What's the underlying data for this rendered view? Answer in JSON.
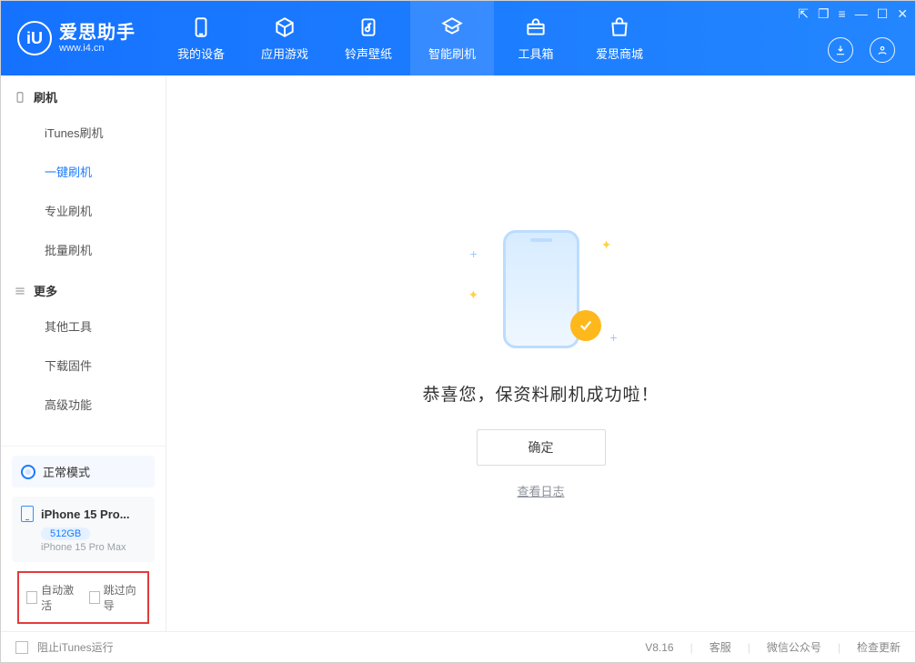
{
  "header": {
    "logo_title": "爱思助手",
    "logo_url": "www.i4.cn",
    "nav": [
      {
        "label": "我的设备",
        "icon": "phone"
      },
      {
        "label": "应用游戏",
        "icon": "cube"
      },
      {
        "label": "铃声壁纸",
        "icon": "music"
      },
      {
        "label": "智能刷机",
        "icon": "refresh",
        "active": true
      },
      {
        "label": "工具箱",
        "icon": "toolbox"
      },
      {
        "label": "爱思商城",
        "icon": "shop"
      }
    ],
    "download_icon": "download",
    "user_icon": "user"
  },
  "sidebar": {
    "groups": [
      {
        "title": "刷机",
        "icon": "device",
        "items": [
          {
            "label": "iTunes刷机"
          },
          {
            "label": "一键刷机",
            "active": true
          },
          {
            "label": "专业刷机"
          },
          {
            "label": "批量刷机"
          }
        ]
      },
      {
        "title": "更多",
        "icon": "more",
        "items": [
          {
            "label": "其他工具"
          },
          {
            "label": "下载固件"
          },
          {
            "label": "高级功能"
          }
        ]
      }
    ],
    "mode_label": "正常模式",
    "device": {
      "name_short": "iPhone 15 Pro...",
      "storage": "512GB",
      "name_full": "iPhone 15 Pro Max"
    },
    "checkbox_auto_activate": "自动激活",
    "checkbox_skip_guide": "跳过向导"
  },
  "main": {
    "success_text": "恭喜您，保资料刷机成功啦！",
    "ok_button": "确定",
    "view_log": "查看日志"
  },
  "footer": {
    "block_itunes": "阻止iTunes运行",
    "version": "V8.16",
    "links": [
      "客服",
      "微信公众号",
      "检查更新"
    ]
  }
}
